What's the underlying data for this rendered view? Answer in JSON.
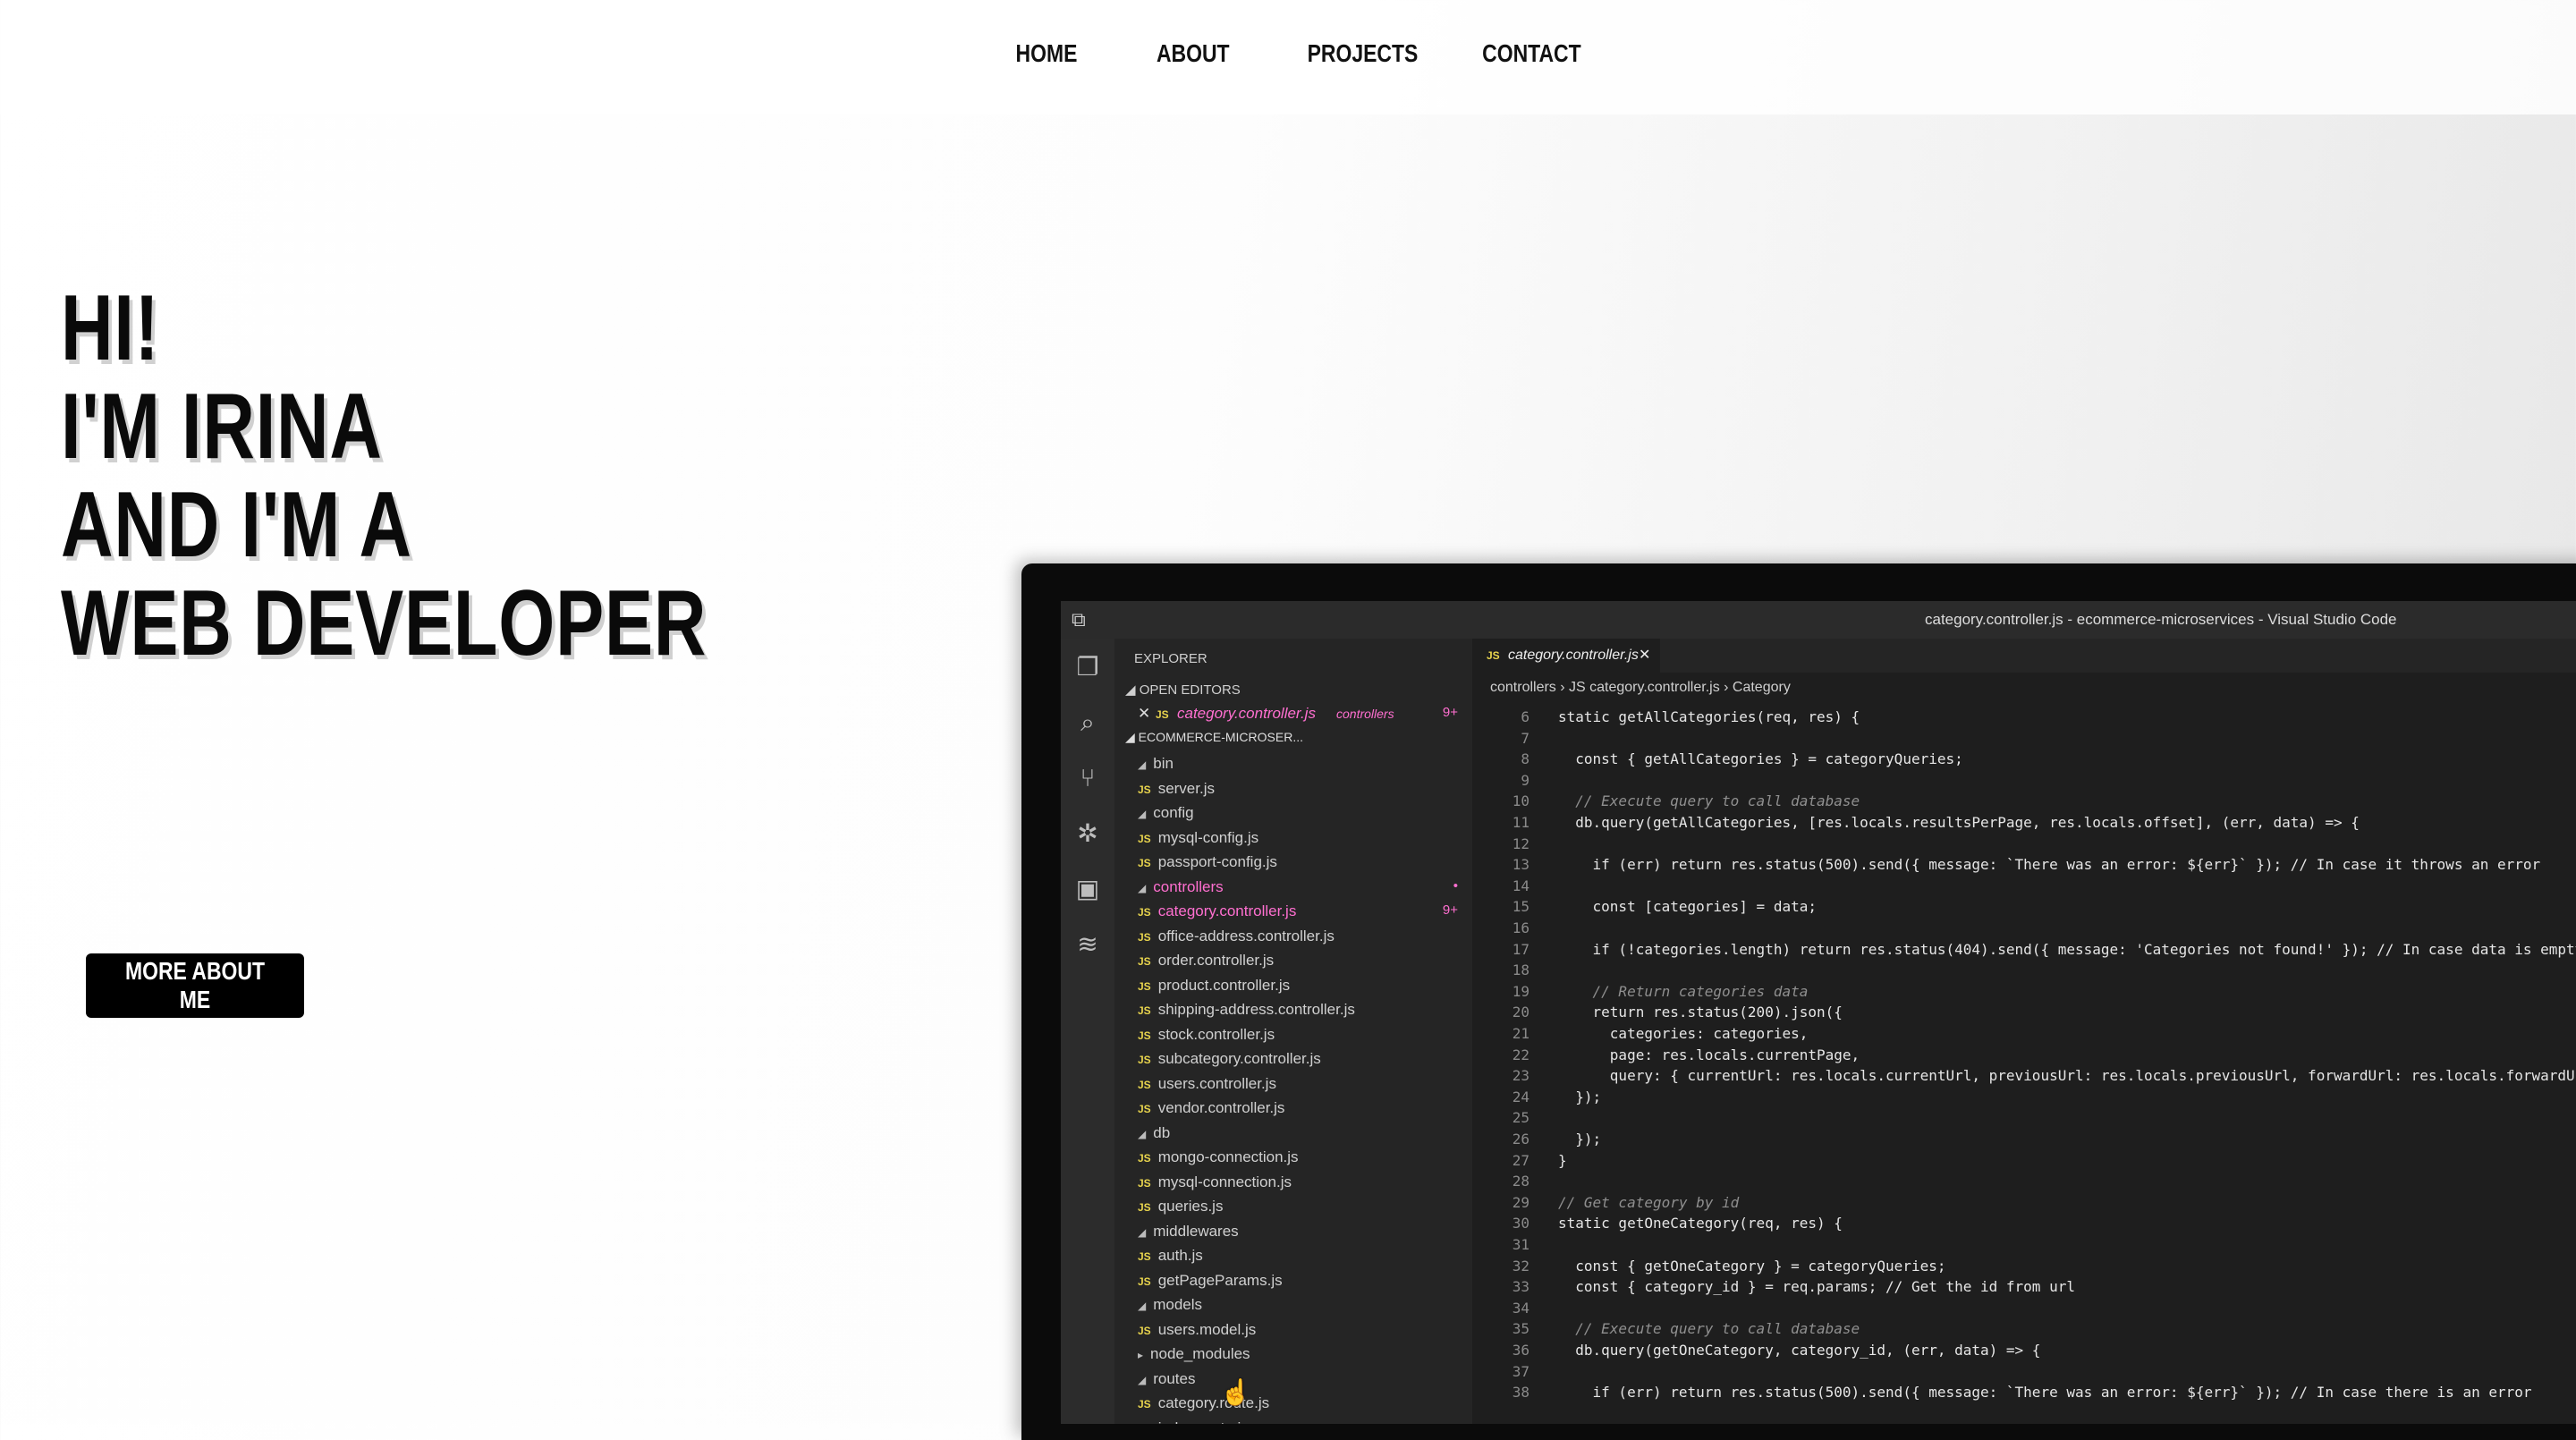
{
  "nav": {
    "items": [
      "HOME",
      "ABOUT",
      "PROJECTS",
      "CONTACT"
    ]
  },
  "hero": {
    "lines": [
      "HI!",
      "I'M IRINA",
      "AND I'M A",
      "WEB DEVELOPER"
    ],
    "button_label": "MORE ABOUT ME"
  },
  "vscode": {
    "window_title": "category.controller.js - ecommerce-microservices - Visual Studio Code",
    "explorer_label": "EXPLORER",
    "open_editors_label": "OPEN EDITORS",
    "open_editor": {
      "file": "category.controller.js",
      "folder": "controllers",
      "badge": "9+"
    },
    "project_label": "ECOMMERCE-MICROSER...",
    "tree": [
      {
        "type": "folder",
        "name": "bin",
        "depth": 0
      },
      {
        "type": "file",
        "name": "server.js",
        "depth": 1
      },
      {
        "type": "folder",
        "name": "config",
        "depth": 0
      },
      {
        "type": "file",
        "name": "mysql-config.js",
        "depth": 1
      },
      {
        "type": "file",
        "name": "passport-config.js",
        "depth": 1
      },
      {
        "type": "folder",
        "name": "controllers",
        "depth": 0,
        "active": true,
        "badge": "•"
      },
      {
        "type": "file",
        "name": "category.controller.js",
        "depth": 1,
        "active": true,
        "badge": "9+"
      },
      {
        "type": "file",
        "name": "office-address.controller.js",
        "depth": 1
      },
      {
        "type": "file",
        "name": "order.controller.js",
        "depth": 1
      },
      {
        "type": "file",
        "name": "product.controller.js",
        "depth": 1
      },
      {
        "type": "file",
        "name": "shipping-address.controller.js",
        "depth": 1
      },
      {
        "type": "file",
        "name": "stock.controller.js",
        "depth": 1
      },
      {
        "type": "file",
        "name": "subcategory.controller.js",
        "depth": 1
      },
      {
        "type": "file",
        "name": "users.controller.js",
        "depth": 1
      },
      {
        "type": "file",
        "name": "vendor.controller.js",
        "depth": 1
      },
      {
        "type": "folder",
        "name": "db",
        "depth": 0
      },
      {
        "type": "file",
        "name": "mongo-connection.js",
        "depth": 1
      },
      {
        "type": "file",
        "name": "mysql-connection.js",
        "depth": 1
      },
      {
        "type": "file",
        "name": "queries.js",
        "depth": 1
      },
      {
        "type": "folder",
        "name": "middlewares",
        "depth": 0
      },
      {
        "type": "file",
        "name": "auth.js",
        "depth": 1
      },
      {
        "type": "file",
        "name": "getPageParams.js",
        "depth": 1
      },
      {
        "type": "folder",
        "name": "models",
        "depth": 0
      },
      {
        "type": "file",
        "name": "users.model.js",
        "depth": 1
      },
      {
        "type": "folder-closed",
        "name": "node_modules",
        "depth": 0
      },
      {
        "type": "folder",
        "name": "routes",
        "depth": 0
      },
      {
        "type": "file",
        "name": "category.route.js",
        "depth": 1
      },
      {
        "type": "file",
        "name": "index.route.js",
        "depth": 1
      }
    ],
    "tab_name": "category.controller.js",
    "breadcrumb": "controllers › JS category.controller.js › Category",
    "code": [
      {
        "n": "6",
        "t": "static getAllCategories(req, res) {"
      },
      {
        "n": "7",
        "t": ""
      },
      {
        "n": "8",
        "t": "  const { getAllCategories } = categoryQueries;"
      },
      {
        "n": "9",
        "t": ""
      },
      {
        "n": "10",
        "t": "  // Execute query to call database",
        "c": true
      },
      {
        "n": "11",
        "t": "  db.query(getAllCategories, [res.locals.resultsPerPage, res.locals.offset], (err, data) => {"
      },
      {
        "n": "12",
        "t": ""
      },
      {
        "n": "13",
        "t": "    if (err) return res.status(500).send({ message: `There was an error: ${err}` }); // In case it throws an error"
      },
      {
        "n": "14",
        "t": ""
      },
      {
        "n": "15",
        "t": "    const [categories] = data;"
      },
      {
        "n": "16",
        "t": ""
      },
      {
        "n": "17",
        "t": "    if (!categories.length) return res.status(404).send({ message: 'Categories not found!' }); // In case data is empty"
      },
      {
        "n": "18",
        "t": ""
      },
      {
        "n": "19",
        "t": "    // Return categories data",
        "c": true
      },
      {
        "n": "20",
        "t": "    return res.status(200).json({"
      },
      {
        "n": "21",
        "t": "      categories: categories,"
      },
      {
        "n": "22",
        "t": "      page: res.locals.currentPage,"
      },
      {
        "n": "23",
        "t": "      query: { currentUrl: res.locals.currentUrl, previousUrl: res.locals.previousUrl, forwardUrl: res.locals.forwardUrl }"
      },
      {
        "n": "24",
        "t": "  });"
      },
      {
        "n": "25",
        "t": ""
      },
      {
        "n": "26",
        "t": "  });"
      },
      {
        "n": "27",
        "t": "}"
      },
      {
        "n": "28",
        "t": ""
      },
      {
        "n": "29",
        "t": "// Get category by id",
        "c": true
      },
      {
        "n": "30",
        "t": "static getOneCategory(req, res) {"
      },
      {
        "n": "31",
        "t": ""
      },
      {
        "n": "32",
        "t": "  const { getOneCategory } = categoryQueries;"
      },
      {
        "n": "33",
        "t": "  const { category_id } = req.params; // Get the id from url"
      },
      {
        "n": "34",
        "t": ""
      },
      {
        "n": "35",
        "t": "  // Execute query to call database",
        "c": true
      },
      {
        "n": "36",
        "t": "  db.query(getOneCategory, category_id, (err, data) => {"
      },
      {
        "n": "37",
        "t": ""
      },
      {
        "n": "38",
        "t": "    if (err) return res.status(500).send({ message: `There was an error: ${err}` }); // In case there is an error"
      }
    ]
  }
}
